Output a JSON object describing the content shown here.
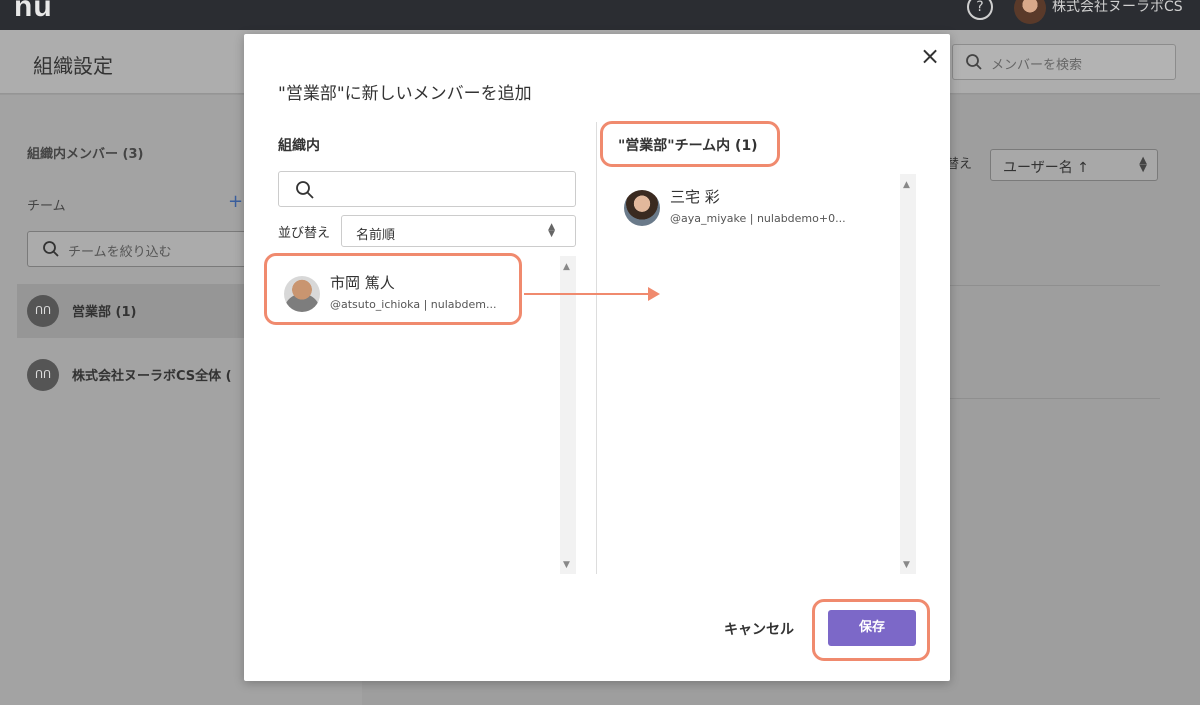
{
  "topbar": {
    "logo": "nu",
    "help_icon": "?",
    "org_name": "株式会社ヌーラボCS"
  },
  "header": {
    "title": "組織設定",
    "search_placeholder": "メンバーを検索"
  },
  "sidebar": {
    "members_label": "組織内メンバー (3)",
    "teams_label": "チーム",
    "add_team": "+",
    "team_filter_placeholder": "チームを絞り込む",
    "teams": [
      {
        "name": "営業部 (1)",
        "selected": true
      },
      {
        "name": "株式会社ヌーラボCS全体 (",
        "selected": false
      }
    ]
  },
  "main": {
    "sort_label": "替え",
    "sort_value": "ユーザー名 ↑"
  },
  "modal": {
    "title": "\"営業部\"に新しいメンバーを追加",
    "close_icon": "×",
    "left": {
      "heading": "組織内",
      "sort_label": "並び替え",
      "sort_value": "名前順",
      "members": [
        {
          "name": "市岡 篤人",
          "sub": "@atsuto_ichioka | nulabdem..."
        }
      ]
    },
    "right": {
      "heading": "\"営業部\"チーム内 (1)",
      "members": [
        {
          "name": "三宅 彩",
          "sub": "@aya_miyake | nulabdemo+0..."
        }
      ]
    },
    "cancel_label": "キャンセル",
    "save_label": "保存"
  },
  "colors": {
    "accent": "#7c68c8",
    "highlight": "#f08a6e"
  }
}
